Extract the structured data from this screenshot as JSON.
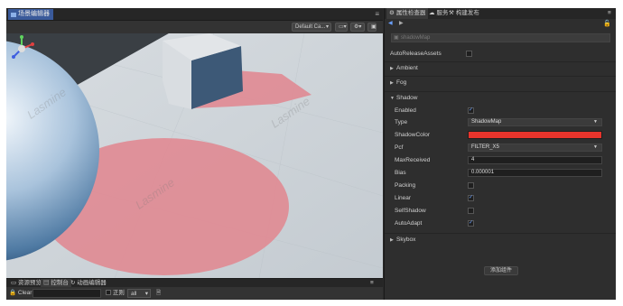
{
  "scene": {
    "tab_label": "场景编辑器",
    "menu_icon": "≡",
    "toolbar": {
      "camera_select": "Default Ca...",
      "view_btn": "▭▾",
      "gear_btn": "⚙▾",
      "grid_btn": "▣"
    },
    "watermark": "Lasmine"
  },
  "console": {
    "tabs": [
      {
        "label": "资源预览"
      },
      {
        "label": "控制台"
      },
      {
        "label": "动画编辑器"
      }
    ],
    "clear_label": "Clear",
    "search_placeholder": "",
    "regex_label": "正则",
    "filter_value": "all",
    "menu_icon": "≡"
  },
  "inspector": {
    "tabs": [
      {
        "label": "属性检查器"
      },
      {
        "label": "服务"
      },
      {
        "label": "构建发布"
      }
    ],
    "menu_icon": "≡",
    "component_name": "shadowMap",
    "auto_release_label": "AutoReleaseAssets",
    "auto_release_checked": false,
    "sections": {
      "ambient": "Ambient",
      "fog": "Fog",
      "shadow": "Shadow",
      "skybox": "Skybox"
    },
    "shadow": {
      "enabled_label": "Enabled",
      "enabled_checked": true,
      "type_label": "Type",
      "type_value": "ShadowMap",
      "color_label": "ShadowColor",
      "color_value": "#e8342c",
      "pcf_label": "Pcf",
      "pcf_value": "FILTER_X5",
      "max_received_label": "MaxReceived",
      "max_received_value": "4",
      "bias_label": "Bias",
      "bias_value": "0.000001",
      "packing_label": "Packing",
      "packing_checked": false,
      "linear_label": "Linear",
      "linear_checked": true,
      "self_shadow_label": "SelfShadow",
      "self_shadow_checked": false,
      "auto_adapt_label": "AutoAdapt",
      "auto_adapt_checked": true
    },
    "add_component_label": "添加组件"
  }
}
